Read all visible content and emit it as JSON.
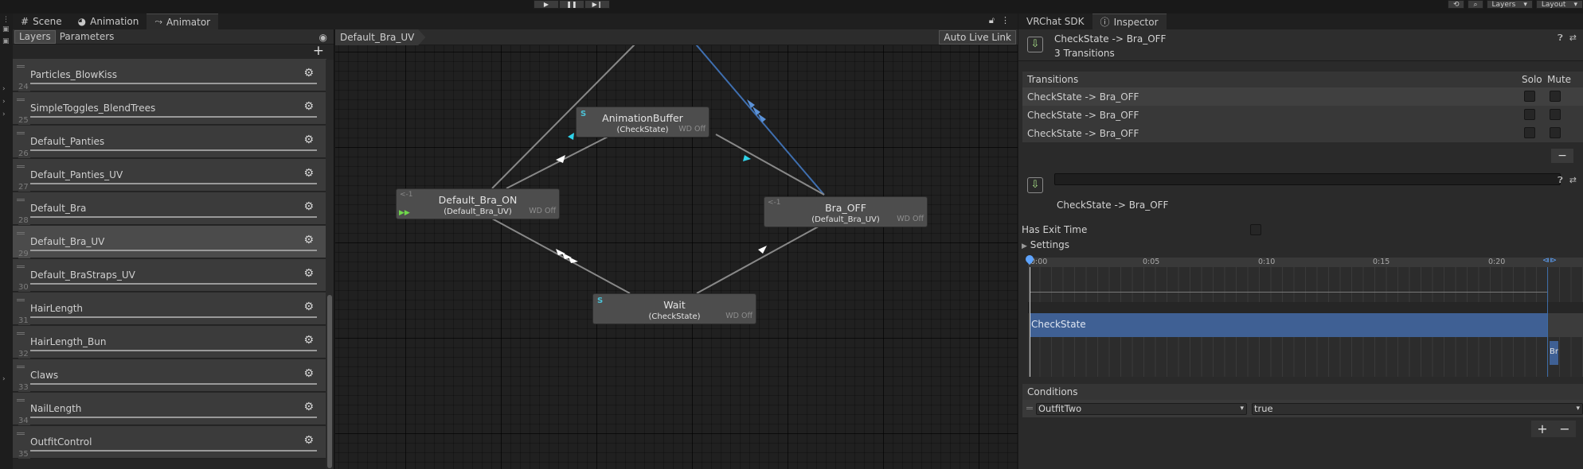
{
  "toolbar": {
    "layers": "Layers",
    "layout": "Layout"
  },
  "left_tabs": [
    {
      "label": "Scene",
      "icon": "grid-icon"
    },
    {
      "label": "Animation",
      "icon": "animation-icon"
    },
    {
      "label": "Animator",
      "icon": "animator-icon",
      "active": true
    }
  ],
  "layer_panel": {
    "tabs": [
      "Layers",
      "Parameters"
    ],
    "layers": [
      {
        "name": "Particles_BlowKiss",
        "index": "24"
      },
      {
        "name": "SimpleToggles_BlendTrees",
        "index": "25"
      },
      {
        "name": "Default_Panties",
        "index": "26"
      },
      {
        "name": "Default_Panties_UV",
        "index": "27"
      },
      {
        "name": "Default_Bra",
        "index": "28"
      },
      {
        "name": "Default_Bra_UV",
        "index": "29",
        "selected": true
      },
      {
        "name": "Default_BraStraps_UV",
        "index": "30"
      },
      {
        "name": "HairLength",
        "index": "31"
      },
      {
        "name": "HairLength_Bun",
        "index": "32"
      },
      {
        "name": "Claws",
        "index": "33"
      },
      {
        "name": "NailLength",
        "index": "34"
      },
      {
        "name": "OutfitControl",
        "index": "35"
      }
    ]
  },
  "graph": {
    "breadcrumb": "Default_Bra_UV",
    "auto_live_link": "Auto Live Link",
    "wd_label": "WD Off",
    "states": {
      "animation_buffer": {
        "name": "AnimationBuffer",
        "sub": "(CheckState)",
        "icon": "S"
      },
      "default_bra_on": {
        "name": "Default_Bra_ON",
        "sub": "(Default_Bra_UV)",
        "tag": "<-1"
      },
      "bra_off": {
        "name": "Bra_OFF",
        "sub": "(Default_Bra_UV)",
        "tag": "<-1"
      },
      "wait": {
        "name": "Wait",
        "sub": "(CheckState)",
        "icon": "S"
      }
    }
  },
  "right_tabs": [
    {
      "label": "VRChat SDK"
    },
    {
      "label": "Inspector",
      "icon": "info-icon",
      "active": true
    }
  ],
  "inspector": {
    "title": "CheckState -> Bra_OFF",
    "subtitle": "3 Transitions",
    "transitions_header": "Transitions",
    "solo": "Solo",
    "mute": "Mute",
    "transitions": [
      "CheckState -> Bra_OFF",
      "CheckState -> Bra_OFF",
      "CheckState -> Bra_OFF"
    ],
    "transition_title": "CheckState -> Bra_OFF",
    "has_exit_time": "Has Exit Time",
    "settings": "Settings",
    "timeline_ticks": [
      "0:00",
      "0:05",
      "0:10",
      "0:15",
      "0:20"
    ],
    "timeline_source": "CheckState",
    "timeline_dest": "Bra_OFF",
    "conditions_header": "Conditions",
    "condition": {
      "parameter": "OutfitTwo",
      "value": "true"
    }
  }
}
